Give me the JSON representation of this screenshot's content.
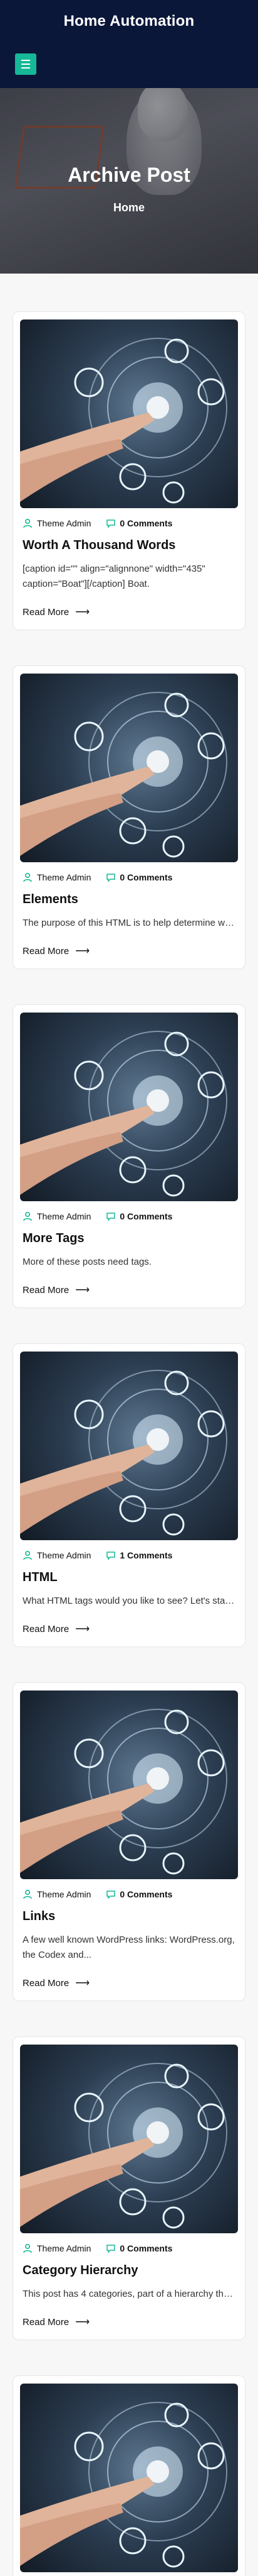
{
  "site": {
    "title": "Home Automation"
  },
  "hero": {
    "title": "Archive Post",
    "breadcrumb": "Home"
  },
  "posts": [
    {
      "author": "Theme Admin",
      "comments": "0 Comments",
      "title": "Worth A Thousand Words",
      "excerpt": "[caption id=\"\" align=\"alignnone\" width=\"435\" caption=\"Boat\"][/caption] Boat.",
      "read_more": "Read More"
    },
    {
      "author": "Theme Admin",
      "comments": "0 Comments",
      "title": "Elements",
      "excerpt": "The purpose of this HTML is to help determine what...",
      "read_more": "Read More"
    },
    {
      "author": "Theme Admin",
      "comments": "0 Comments",
      "title": "More Tags",
      "excerpt": "More of these posts need tags.",
      "read_more": "Read More"
    },
    {
      "author": "Theme Admin",
      "comments": "1 Comments",
      "title": "HTML",
      "excerpt": "What HTML tags would you like to see? Let's start...",
      "read_more": "Read More"
    },
    {
      "author": "Theme Admin",
      "comments": "0 Comments",
      "title": "Links",
      "excerpt": "A few well known WordPress links: WordPress.org, the Codex and...",
      "read_more": "Read More"
    },
    {
      "author": "Theme Admin",
      "comments": "0 Comments",
      "title": "Category Hierarchy",
      "excerpt": "This post has 4 categories, part of a hierarchy that...",
      "read_more": "Read More"
    },
    {
      "author": "",
      "comments": "",
      "title": "",
      "excerpt": "",
      "read_more": ""
    }
  ],
  "colors": {
    "header_bg": "#0b1739",
    "accent": "#17b897"
  }
}
